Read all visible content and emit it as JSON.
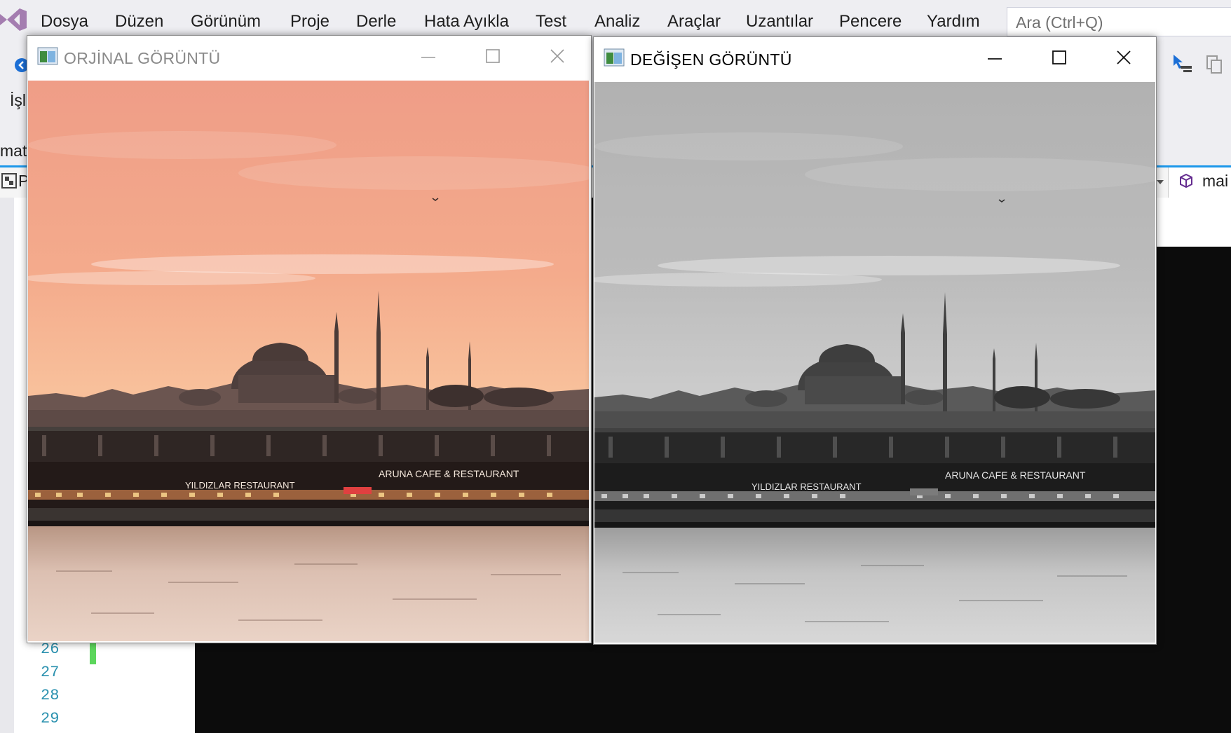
{
  "menu": {
    "items": [
      "Dosya",
      "Düzen",
      "Görünüm",
      "Proje",
      "Derle",
      "Hata Ayıkla",
      "Test",
      "Analiz",
      "Araçlar",
      "Uzantılar",
      "Pencere",
      "Yardım"
    ],
    "search_placeholder": "Ara (Ctrl+Q)"
  },
  "vs_fragments": {
    "toolbar_label": "İşl",
    "solution_text": "mat.",
    "project_tab": "P",
    "member_tab": "mai"
  },
  "editor": {
    "line_numbers": [
      "26",
      "27",
      "28",
      "29"
    ],
    "changed_line_color": "#5cd65c"
  },
  "windows": {
    "original": {
      "title": "ORJİNAL GÖRÜNTÜ",
      "active": false,
      "title_color": "#8a8a8a",
      "image": "Galata Bridge and Süleymaniye Mosque, Istanbul, at sunset (color)",
      "sign_left": "YILDIZLAR RESTAURANT",
      "sign_right": "ARUNA CAFE & RESTAURANT"
    },
    "modified": {
      "title": "DEĞİŞEN GÖRÜNTÜ",
      "active": true,
      "title_color": "#000000",
      "image": "Galata Bridge and Süleymaniye Mosque, Istanbul, at sunset (grayscale)",
      "sign_left": "YILDIZLAR RESTAURANT",
      "sign_right": "ARUNA CAFE & RESTAURANT"
    }
  },
  "colors": {
    "vs_chrome": "#eeeef2",
    "vs_accent": "#1c97ea",
    "console_bg": "#0c0c0c",
    "line_number": "#2b91af"
  }
}
